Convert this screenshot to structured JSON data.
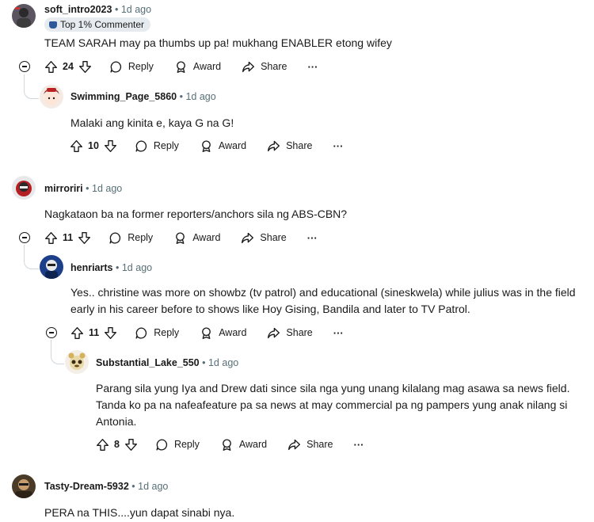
{
  "comments": [
    {
      "author": "soft_intro2023",
      "time": "1d ago",
      "badge": "Top 1% Commenter",
      "body": "TEAM SARAH may pa thumbs up pa! mukhang ENABLER etong wifey",
      "votes": "24",
      "reply_label": "Reply",
      "award_label": "Award",
      "share_label": "Share",
      "more_label": "···"
    },
    {
      "author": "Swimming_Page_5860",
      "time": "1d ago",
      "body": "Malaki ang kinita e, kaya G na G!",
      "votes": "10",
      "reply_label": "Reply",
      "award_label": "Award",
      "share_label": "Share",
      "more_label": "···"
    },
    {
      "author": "mirroriri",
      "time": "1d ago",
      "body": "Nagkataon ba na former reporters/anchors sila ng ABS-CBN?",
      "votes": "11",
      "reply_label": "Reply",
      "award_label": "Award",
      "share_label": "Share",
      "more_label": "···"
    },
    {
      "author": "henriarts",
      "time": "1d ago",
      "body_line1": "Yes.. christine was more on showbz (tv patrol) and educational (sineskwela) while julius was in the field",
      "body_line2": "early in his career before to shows like Hoy Gising, Bandila and later to TV Patrol.",
      "votes": "11",
      "reply_label": "Reply",
      "award_label": "Award",
      "share_label": "Share",
      "more_label": "···"
    },
    {
      "author": "Substantial_Lake_550",
      "time": "1d ago",
      "body_line1": "Parang sila yung Iya and Drew dati since sila nga yung unang kilalang mag asawa sa news field.",
      "body_line2": "Tanda ko pa na nafeafeature pa sa news at may commercial pa ng pampers yung anak nilang si",
      "body_line3": "Antonia.",
      "votes": "8",
      "reply_label": "Reply",
      "award_label": "Award",
      "share_label": "Share",
      "more_label": "···"
    },
    {
      "author": "Tasty-Dream-5932",
      "time": "1d ago",
      "body": "PERA na THIS....yun dapat sinabi nya."
    }
  ],
  "separator": "•",
  "colors": {
    "text": "#1a1a1b",
    "meta": "#576f76",
    "thread": "#d0d6d9",
    "badge_bg": "#e5ebee"
  },
  "icons": [
    "upvote-icon",
    "downvote-icon",
    "reply-bubble-icon",
    "award-icon",
    "share-arrow-icon",
    "more-icon",
    "collapse-icon"
  ]
}
